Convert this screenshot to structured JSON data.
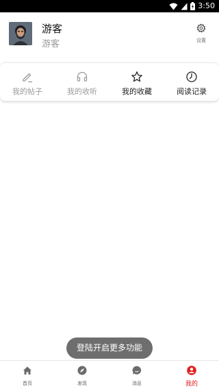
{
  "status_bar": {
    "time": "3:50"
  },
  "profile": {
    "name": "游客",
    "subtitle": "游客",
    "settings_label": "设置"
  },
  "menu": [
    {
      "label": "我的帖子",
      "icon": "pencil-icon",
      "color": "#9a9a9a"
    },
    {
      "label": "我的收听",
      "icon": "headphones-icon",
      "color": "#9a9a9a"
    },
    {
      "label": "我的收藏",
      "icon": "star-icon",
      "color": "#222222"
    },
    {
      "label": "阅读记录",
      "icon": "clock-icon",
      "color": "#222222"
    }
  ],
  "toast": {
    "text": "登陆开启更多功能"
  },
  "bottom_nav": [
    {
      "label": "首页",
      "icon": "home-icon"
    },
    {
      "label": "发现",
      "icon": "compass-icon"
    },
    {
      "label": "消息",
      "icon": "message-icon"
    },
    {
      "label": "我的",
      "icon": "user-icon",
      "active": true
    }
  ],
  "colors": {
    "accent": "#e02020",
    "nav_icon": "#6b6b6b",
    "toast_bg": "#6e6e6e"
  }
}
